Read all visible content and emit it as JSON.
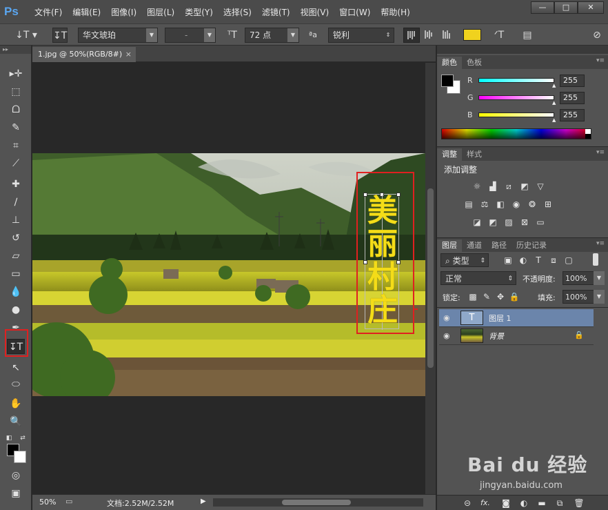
{
  "app": {
    "logo": "Ps"
  },
  "menu": [
    "文件(F)",
    "编辑(E)",
    "图像(I)",
    "图层(L)",
    "类型(Y)",
    "选择(S)",
    "滤镜(T)",
    "视图(V)",
    "窗口(W)",
    "帮助(H)"
  ],
  "window_controls": {
    "minimize": "—",
    "maximize": "□",
    "close": "✕"
  },
  "options": {
    "font_family": "华文琥珀",
    "font_style": "-",
    "font_size": "72 点",
    "aa_label": "ªa",
    "antialias": "锐利",
    "text_color": "#f0d21e"
  },
  "document": {
    "tab_title": "1.jpg @ 50%(RGB/8#)",
    "tab_close": "×",
    "vertical_text": [
      "美",
      "丽",
      "村",
      "庄"
    ],
    "zoom": "50%",
    "doc_info": "文档:2.52M/2.52M"
  },
  "color_panel": {
    "tabs": [
      "颜色",
      "色板"
    ],
    "channels": [
      {
        "label": "R",
        "value": "255"
      },
      {
        "label": "G",
        "value": "255"
      },
      {
        "label": "B",
        "value": "255"
      }
    ]
  },
  "adjust_panel": {
    "tabs": [
      "调整",
      "样式"
    ],
    "title": "添加调整"
  },
  "layers_panel": {
    "tabs": [
      "图层",
      "通道",
      "路径",
      "历史记录"
    ],
    "filter": "类型",
    "blend_mode": "正常",
    "opacity_label": "不透明度:",
    "opacity": "100%",
    "lock_label": "锁定:",
    "fill_label": "填充:",
    "fill": "100%",
    "layers": [
      {
        "name": "图层 1",
        "type": "text",
        "selected": true
      },
      {
        "name": "背景",
        "type": "image",
        "locked": true
      }
    ],
    "footer_fx": "fx."
  },
  "watermark": {
    "brand": "Bai du 经验",
    "url": "jingyan.baidu.com"
  }
}
